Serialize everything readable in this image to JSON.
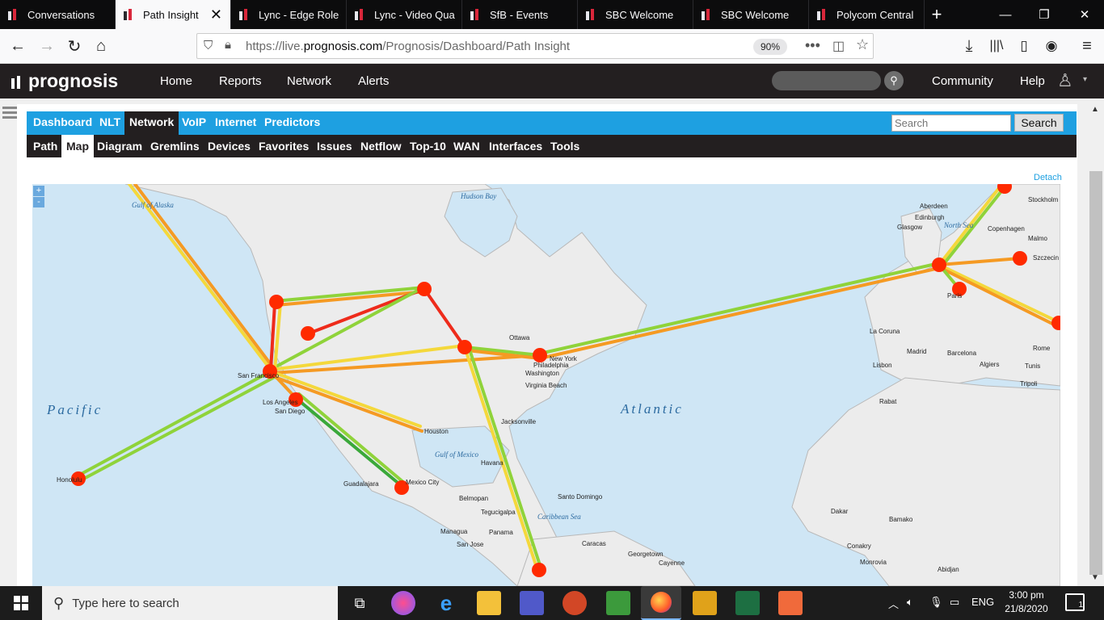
{
  "browser": {
    "tabs": [
      {
        "title": "Conversations",
        "active": false
      },
      {
        "title": "Path Insight",
        "active": true
      },
      {
        "title": "Lync - Edge Role",
        "active": false
      },
      {
        "title": "Lync - Video Qua",
        "active": false
      },
      {
        "title": "SfB - Events",
        "active": false
      },
      {
        "title": "SBC Welcome",
        "active": false
      },
      {
        "title": "SBC Welcome",
        "active": false
      },
      {
        "title": "Polycom Central",
        "active": false
      }
    ],
    "url_prefix": "https://live.",
    "url_domain": "prognosis.com",
    "url_path": "/Prognosis/Dashboard/Path Insight",
    "zoom": "90%"
  },
  "app": {
    "logo": "prognosis",
    "nav": [
      "Home",
      "Reports",
      "Network",
      "Alerts"
    ],
    "community": "Community",
    "help": "Help"
  },
  "tabs_top": [
    "Dashboard",
    "NLT",
    "Network",
    "VoIP",
    "Internet",
    "Predictors"
  ],
  "tabs_top_active": "Network",
  "tabs_sub": [
    "Path",
    "Map",
    "Diagram",
    "Gremlins",
    "Devices",
    "Favorites",
    "Issues",
    "Netflow",
    "Top-10",
    "WAN",
    "Interfaces",
    "Tools"
  ],
  "tabs_sub_active": "Map",
  "search": {
    "placeholder": "Search",
    "button": "Search"
  },
  "detach": "Detach",
  "map": {
    "zoom_in": "+",
    "zoom_out": "-",
    "ocean_labels": [
      "Pacific",
      "Atlantic"
    ],
    "region_labels": [
      "Hudson Bay",
      "Gulf of Alaska",
      "Gulf of Mexico",
      "Caribbean Sea",
      "North Sea"
    ],
    "city_labels": [
      "Ottawa",
      "New York",
      "Philadelphia",
      "Washington",
      "Virginia Beach",
      "Jacksonville",
      "Houston",
      "Los Angeles",
      "San Diego",
      "San Francisco",
      "Guadalajara",
      "Mexico City",
      "Havana",
      "Belmopan",
      "Tegucigalpa",
      "Managua",
      "San Jose",
      "Panama",
      "Caracas",
      "Santo Domingo",
      "Georgetown",
      "Cayenne",
      "Honolulu",
      "La Coruna",
      "Madrid",
      "Barcelona",
      "Lisbon",
      "Rabat",
      "Dakar",
      "Bamako",
      "Conakry",
      "Monrovia",
      "Abidjan",
      "Edinburgh",
      "Copenhagen",
      "Paris",
      "Rome",
      "Tunis",
      "Algiers",
      "Tripoli",
      "Glasgow",
      "Aberdeen",
      "Stockholm",
      "Szczecin",
      "Malmo"
    ]
  },
  "taskbar": {
    "search_placeholder": "Type here to search",
    "lang": "ENG",
    "time": "3:00 pm",
    "date": "21/8/2020",
    "notifications": "1"
  }
}
